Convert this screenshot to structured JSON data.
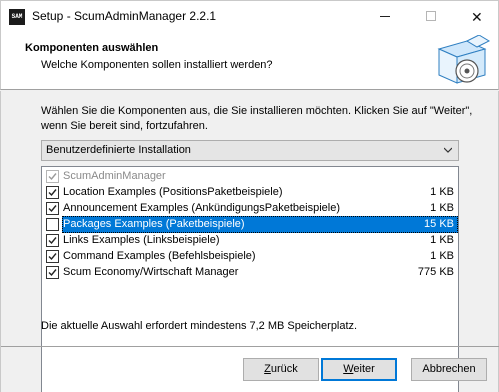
{
  "window": {
    "title": "Setup - ScumAdminManager 2.2.1",
    "app_icon_text": "SAM"
  },
  "header": {
    "title": "Komponenten auswählen",
    "subtitle": "Welche Komponenten sollen installiert werden?"
  },
  "intro": "Wählen Sie die Komponenten aus, die Sie installieren möchten. Klicken Sie auf \"Weiter\", wenn Sie bereit sind, fortzufahren.",
  "install_type": {
    "selected": "Benutzerdefinierte Installation"
  },
  "components": [
    {
      "label": "ScumAdminManager",
      "size": "",
      "checked": true,
      "disabled": true,
      "selected": false
    },
    {
      "label": "Location Examples (PositionsPaketbeispiele)",
      "size": "1 KB",
      "checked": true,
      "disabled": false,
      "selected": false
    },
    {
      "label": "Announcement Examples (AnkündigungsPaketbeispiele)",
      "size": "1 KB",
      "checked": true,
      "disabled": false,
      "selected": false
    },
    {
      "label": "Packages Examples (Paketbeispiele)",
      "size": "15 KB",
      "checked": false,
      "disabled": false,
      "selected": true
    },
    {
      "label": "Links Examples (Linksbeispiele)",
      "size": "1 KB",
      "checked": true,
      "disabled": false,
      "selected": false
    },
    {
      "label": "Command Examples (Befehlsbeispiele)",
      "size": "1 KB",
      "checked": true,
      "disabled": false,
      "selected": false
    },
    {
      "label": "Scum Economy/Wirtschaft Manager",
      "size": "775 KB",
      "checked": true,
      "disabled": false,
      "selected": false
    }
  ],
  "space_required": "Die aktuelle Auswahl erfordert mindestens 7,2 MB Speicherplatz.",
  "buttons": {
    "back": {
      "mnemonic": "Z",
      "rest": "urück"
    },
    "next": {
      "mnemonic": "W",
      "rest": "eiter"
    },
    "cancel": "Abbrechen"
  },
  "colors": {
    "selection": "#0078d7",
    "window_bg": "#f0f0f0"
  }
}
